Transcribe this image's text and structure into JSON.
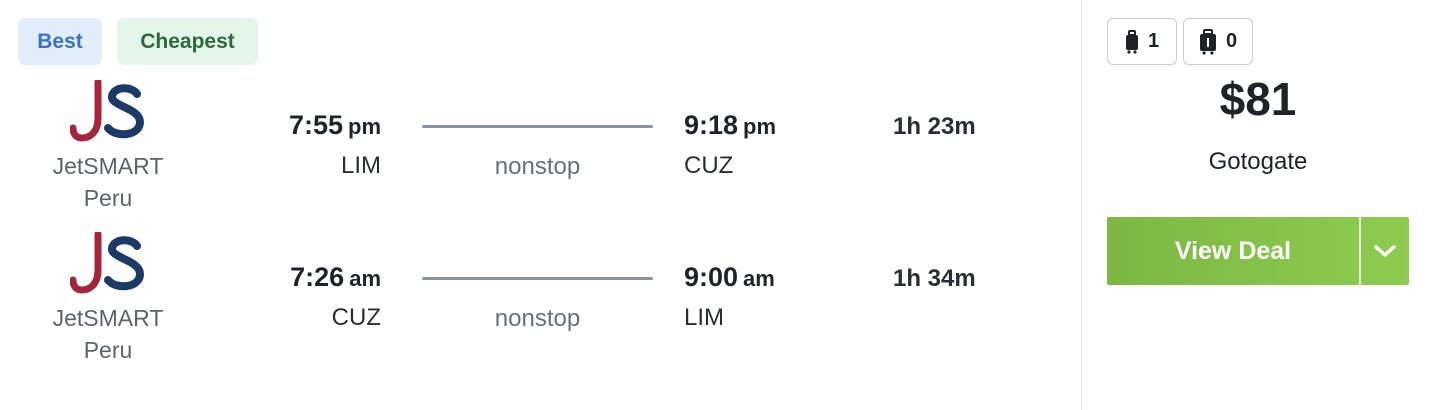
{
  "badges": {
    "best": "Best",
    "cheapest": "Cheapest"
  },
  "legs": [
    {
      "airline": "JetSMART Peru",
      "logo_text": "JS",
      "departure": {
        "time": "7:55",
        "ampm": "pm",
        "code": "LIM"
      },
      "stops": "nonstop",
      "arrival": {
        "time": "9:18",
        "ampm": "pm",
        "code": "CUZ"
      },
      "duration": "1h 23m"
    },
    {
      "airline": "JetSMART Peru",
      "logo_text": "JS",
      "departure": {
        "time": "7:26",
        "ampm": "am",
        "code": "CUZ"
      },
      "stops": "nonstop",
      "arrival": {
        "time": "9:00",
        "ampm": "am",
        "code": "LIM"
      },
      "duration": "1h 34m"
    }
  ],
  "bags": {
    "carry_on": {
      "icon": "carry-on-bag-icon",
      "count": "1"
    },
    "checked": {
      "icon": "checked-bag-icon",
      "count": "0"
    }
  },
  "price": "$81",
  "provider": "Gotogate",
  "deal_button": {
    "label": "View Deal",
    "toggle_icon": "chevron-down-icon"
  },
  "colors": {
    "logo_j": "#a3263a",
    "logo_s": "#1c3a66",
    "deal_green": "#87c34a",
    "best_bg": "#e3eefc",
    "cheapest_bg": "#e4f6ea"
  }
}
